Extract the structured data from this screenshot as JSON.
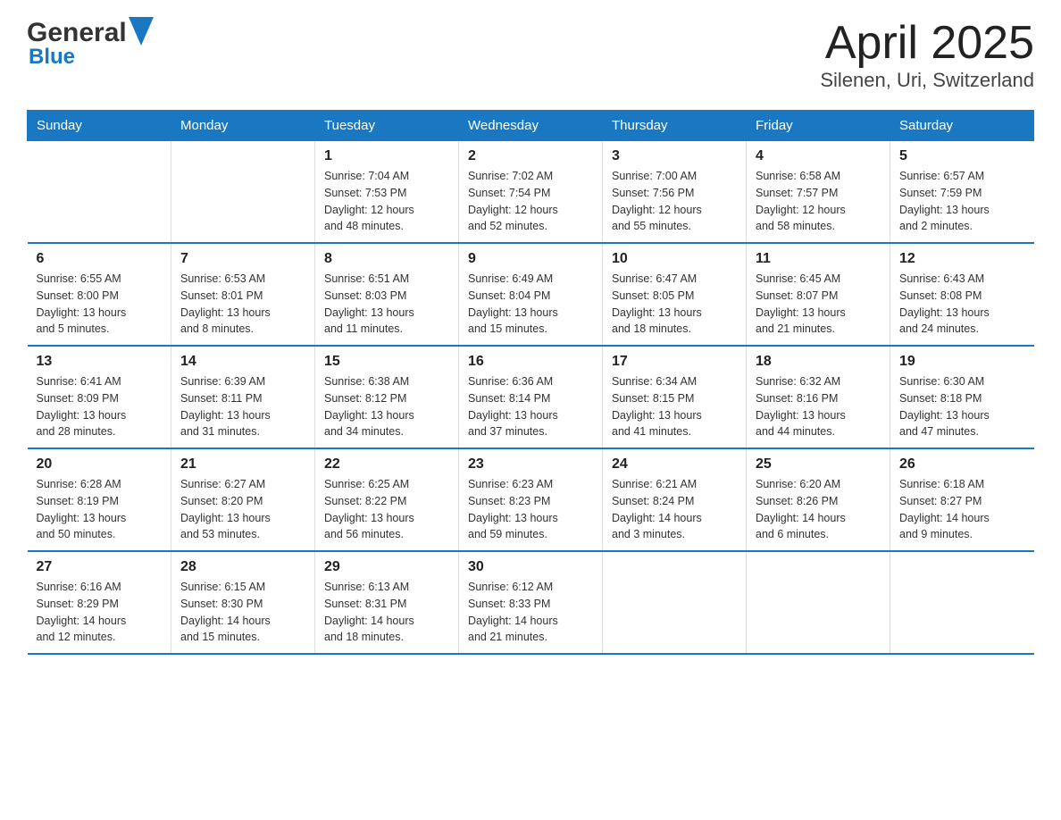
{
  "header": {
    "logo_general": "General",
    "logo_blue": "Blue",
    "title": "April 2025",
    "subtitle": "Silenen, Uri, Switzerland"
  },
  "days_of_week": [
    "Sunday",
    "Monday",
    "Tuesday",
    "Wednesday",
    "Thursday",
    "Friday",
    "Saturday"
  ],
  "weeks": [
    [
      {
        "day": "",
        "info": ""
      },
      {
        "day": "",
        "info": ""
      },
      {
        "day": "1",
        "info": "Sunrise: 7:04 AM\nSunset: 7:53 PM\nDaylight: 12 hours\nand 48 minutes."
      },
      {
        "day": "2",
        "info": "Sunrise: 7:02 AM\nSunset: 7:54 PM\nDaylight: 12 hours\nand 52 minutes."
      },
      {
        "day": "3",
        "info": "Sunrise: 7:00 AM\nSunset: 7:56 PM\nDaylight: 12 hours\nand 55 minutes."
      },
      {
        "day": "4",
        "info": "Sunrise: 6:58 AM\nSunset: 7:57 PM\nDaylight: 12 hours\nand 58 minutes."
      },
      {
        "day": "5",
        "info": "Sunrise: 6:57 AM\nSunset: 7:59 PM\nDaylight: 13 hours\nand 2 minutes."
      }
    ],
    [
      {
        "day": "6",
        "info": "Sunrise: 6:55 AM\nSunset: 8:00 PM\nDaylight: 13 hours\nand 5 minutes."
      },
      {
        "day": "7",
        "info": "Sunrise: 6:53 AM\nSunset: 8:01 PM\nDaylight: 13 hours\nand 8 minutes."
      },
      {
        "day": "8",
        "info": "Sunrise: 6:51 AM\nSunset: 8:03 PM\nDaylight: 13 hours\nand 11 minutes."
      },
      {
        "day": "9",
        "info": "Sunrise: 6:49 AM\nSunset: 8:04 PM\nDaylight: 13 hours\nand 15 minutes."
      },
      {
        "day": "10",
        "info": "Sunrise: 6:47 AM\nSunset: 8:05 PM\nDaylight: 13 hours\nand 18 minutes."
      },
      {
        "day": "11",
        "info": "Sunrise: 6:45 AM\nSunset: 8:07 PM\nDaylight: 13 hours\nand 21 minutes."
      },
      {
        "day": "12",
        "info": "Sunrise: 6:43 AM\nSunset: 8:08 PM\nDaylight: 13 hours\nand 24 minutes."
      }
    ],
    [
      {
        "day": "13",
        "info": "Sunrise: 6:41 AM\nSunset: 8:09 PM\nDaylight: 13 hours\nand 28 minutes."
      },
      {
        "day": "14",
        "info": "Sunrise: 6:39 AM\nSunset: 8:11 PM\nDaylight: 13 hours\nand 31 minutes."
      },
      {
        "day": "15",
        "info": "Sunrise: 6:38 AM\nSunset: 8:12 PM\nDaylight: 13 hours\nand 34 minutes."
      },
      {
        "day": "16",
        "info": "Sunrise: 6:36 AM\nSunset: 8:14 PM\nDaylight: 13 hours\nand 37 minutes."
      },
      {
        "day": "17",
        "info": "Sunrise: 6:34 AM\nSunset: 8:15 PM\nDaylight: 13 hours\nand 41 minutes."
      },
      {
        "day": "18",
        "info": "Sunrise: 6:32 AM\nSunset: 8:16 PM\nDaylight: 13 hours\nand 44 minutes."
      },
      {
        "day": "19",
        "info": "Sunrise: 6:30 AM\nSunset: 8:18 PM\nDaylight: 13 hours\nand 47 minutes."
      }
    ],
    [
      {
        "day": "20",
        "info": "Sunrise: 6:28 AM\nSunset: 8:19 PM\nDaylight: 13 hours\nand 50 minutes."
      },
      {
        "day": "21",
        "info": "Sunrise: 6:27 AM\nSunset: 8:20 PM\nDaylight: 13 hours\nand 53 minutes."
      },
      {
        "day": "22",
        "info": "Sunrise: 6:25 AM\nSunset: 8:22 PM\nDaylight: 13 hours\nand 56 minutes."
      },
      {
        "day": "23",
        "info": "Sunrise: 6:23 AM\nSunset: 8:23 PM\nDaylight: 13 hours\nand 59 minutes."
      },
      {
        "day": "24",
        "info": "Sunrise: 6:21 AM\nSunset: 8:24 PM\nDaylight: 14 hours\nand 3 minutes."
      },
      {
        "day": "25",
        "info": "Sunrise: 6:20 AM\nSunset: 8:26 PM\nDaylight: 14 hours\nand 6 minutes."
      },
      {
        "day": "26",
        "info": "Sunrise: 6:18 AM\nSunset: 8:27 PM\nDaylight: 14 hours\nand 9 minutes."
      }
    ],
    [
      {
        "day": "27",
        "info": "Sunrise: 6:16 AM\nSunset: 8:29 PM\nDaylight: 14 hours\nand 12 minutes."
      },
      {
        "day": "28",
        "info": "Sunrise: 6:15 AM\nSunset: 8:30 PM\nDaylight: 14 hours\nand 15 minutes."
      },
      {
        "day": "29",
        "info": "Sunrise: 6:13 AM\nSunset: 8:31 PM\nDaylight: 14 hours\nand 18 minutes."
      },
      {
        "day": "30",
        "info": "Sunrise: 6:12 AM\nSunset: 8:33 PM\nDaylight: 14 hours\nand 21 minutes."
      },
      {
        "day": "",
        "info": ""
      },
      {
        "day": "",
        "info": ""
      },
      {
        "day": "",
        "info": ""
      }
    ]
  ]
}
